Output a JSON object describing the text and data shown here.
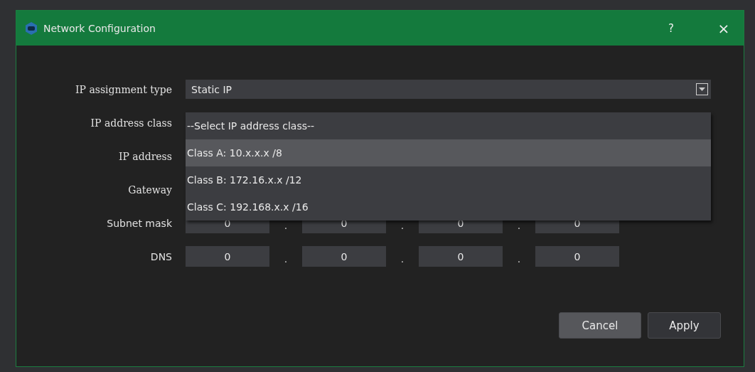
{
  "window": {
    "title": "Network Configuration",
    "help": "?",
    "close": "×"
  },
  "assignment": {
    "label": "IP assignment type",
    "value": "Static IP"
  },
  "address_class": {
    "label": "IP address class",
    "placeholder": "--Select IP address class--",
    "expanded": true,
    "options": [
      {
        "label": "Class A: 10.x.x.x /8",
        "selected": true
      },
      {
        "label": "Class B: 172.16.x.x /12",
        "selected": false
      },
      {
        "label": "Class C: 192.168.x.x /16",
        "selected": false
      }
    ]
  },
  "rows": [
    {
      "label": "IP address"
    },
    {
      "label": "Gateway"
    },
    {
      "label": "Subnet mask",
      "octets": [
        "0",
        "0",
        "0",
        "0"
      ]
    },
    {
      "label": "DNS",
      "octets": [
        "0",
        "0",
        "0",
        "0"
      ]
    }
  ],
  "separator": ".",
  "buttons": [
    {
      "label": "Cancel",
      "kind": "secondary"
    },
    {
      "label": "Apply",
      "kind": "primary"
    }
  ]
}
